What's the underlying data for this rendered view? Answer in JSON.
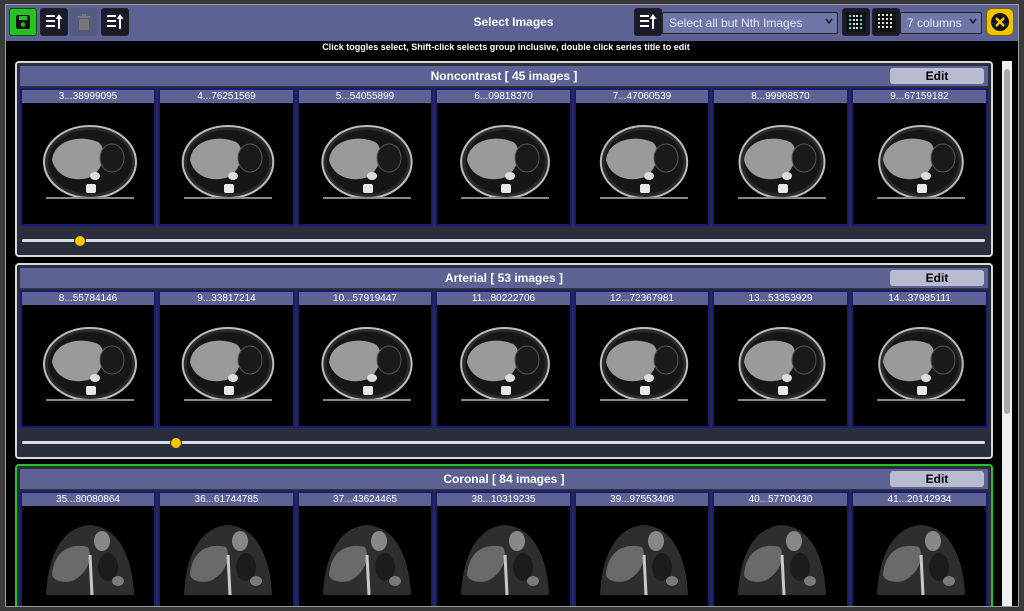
{
  "toolbar": {
    "title": "Select Images",
    "select_mode": "Select all but Nth Images",
    "columns": "7 columns"
  },
  "hint": "Click toggles select, Shift-click selects group inclusive, double click series title to edit",
  "series": [
    {
      "title": "Noncontrast [ 45 images ]",
      "edit_label": "Edit",
      "selected": false,
      "kind": "axial",
      "slider_fraction": 0.06,
      "tiles": [
        "3...38999095",
        "4...76251569",
        "5...54055899",
        "6...09818370",
        "7...47060539",
        "8...99968570",
        "9...67159182"
      ]
    },
    {
      "title": "Arterial [ 53 images ]",
      "edit_label": "Edit",
      "selected": false,
      "kind": "axial",
      "slider_fraction": 0.16,
      "tiles": [
        "8...55784146",
        "9...33817214",
        "10...57919447",
        "11...80222706",
        "12...72367981",
        "13...53353929",
        "14...37985111"
      ]
    },
    {
      "title": "Coronal [ 84 images ]",
      "edit_label": "Edit",
      "selected": true,
      "kind": "coronal",
      "slider_fraction": 0.4,
      "tiles": [
        "35...80080864",
        "36...61744785",
        "37...43624465",
        "38...10319235",
        "39...97553408",
        "40...57700430",
        "41...20142934"
      ]
    }
  ],
  "colors": {
    "toolbar": "#5c6394",
    "selected_border": "#22c322",
    "slider_knob": "#f2c400",
    "close_button": "#f2c400"
  },
  "icons": {
    "save": "save-icon",
    "sort_up": "sort-up-icon",
    "delete": "trash-icon",
    "sort_down": "sort-down-icon",
    "sort_options": "sort-icon",
    "columns_small": "grid-small-icon",
    "columns_large": "grid-large-icon",
    "close": "close-icon"
  }
}
